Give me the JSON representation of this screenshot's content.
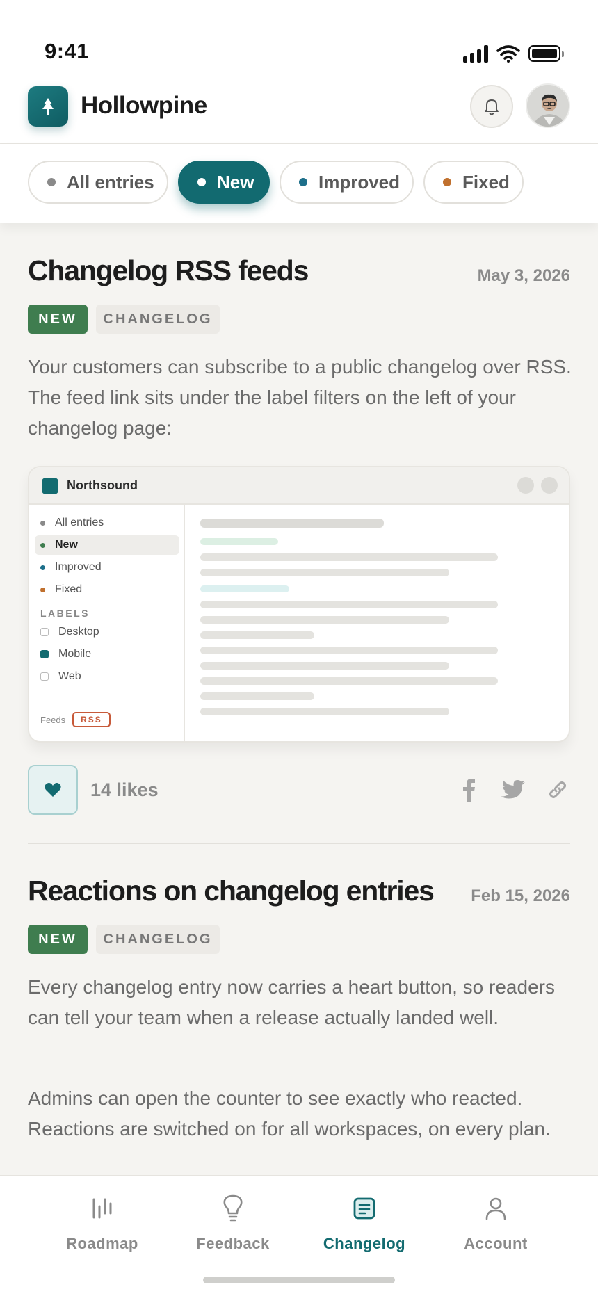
{
  "status": {
    "time": "9:41"
  },
  "header": {
    "app_name": "Hollowpine"
  },
  "filters": [
    {
      "label": "All entries",
      "dot_color": "#8a8a8a",
      "active": false
    },
    {
      "label": "New",
      "dot_color": "#ffffff",
      "active": true
    },
    {
      "label": "Improved",
      "dot_color": "#1d6f8a",
      "active": false
    },
    {
      "label": "Fixed",
      "dot_color": "#c0702e",
      "active": false
    }
  ],
  "entries": [
    {
      "title": "Changelog RSS feeds",
      "date": "May 3, 2026",
      "tags": [
        "NEW",
        "CHANGELOG"
      ],
      "paragraphs": [
        "Your customers can subscribe to a public changelog over RSS. The feed link sits under the label filters on the left of your changelog page:"
      ],
      "likes": "14 likes"
    },
    {
      "title": "Reactions on changelog entries",
      "date": "Feb 15, 2026",
      "tags": [
        "NEW",
        "CHANGELOG"
      ],
      "paragraphs": [
        "Every changelog entry now carries a heart button, so readers can tell your team when a release actually landed well.",
        "Admins can open the counter to see exactly who reacted. Reactions are switched on for all workspaces, on every plan."
      ]
    }
  ],
  "mock": {
    "app_name": "Northsound",
    "sidebar": [
      {
        "label": "All entries",
        "dot": "#8a8a8a"
      },
      {
        "label": "New",
        "dot": "#3f7d4f"
      },
      {
        "label": "Improved",
        "dot": "#1d6f8a"
      },
      {
        "label": "Fixed",
        "dot": "#c0702e"
      }
    ],
    "labels_heading": "LABELS",
    "labels": [
      {
        "label": "Desktop",
        "checked": false
      },
      {
        "label": "Mobile",
        "checked": true
      },
      {
        "label": "Web",
        "checked": false
      }
    ],
    "feeds_label": "Feeds",
    "rss_label": "RSS"
  },
  "tabs": [
    {
      "label": "Roadmap",
      "icon": "roadmap-icon",
      "active": false
    },
    {
      "label": "Feedback",
      "icon": "lightbulb-icon",
      "active": false
    },
    {
      "label": "Changelog",
      "icon": "changelog-icon",
      "active": true
    },
    {
      "label": "Account",
      "icon": "person-icon",
      "active": false
    }
  ],
  "colors": {
    "accent": "#136b70",
    "new_tag": "#3f7d4f",
    "background": "#f5f4f1"
  }
}
